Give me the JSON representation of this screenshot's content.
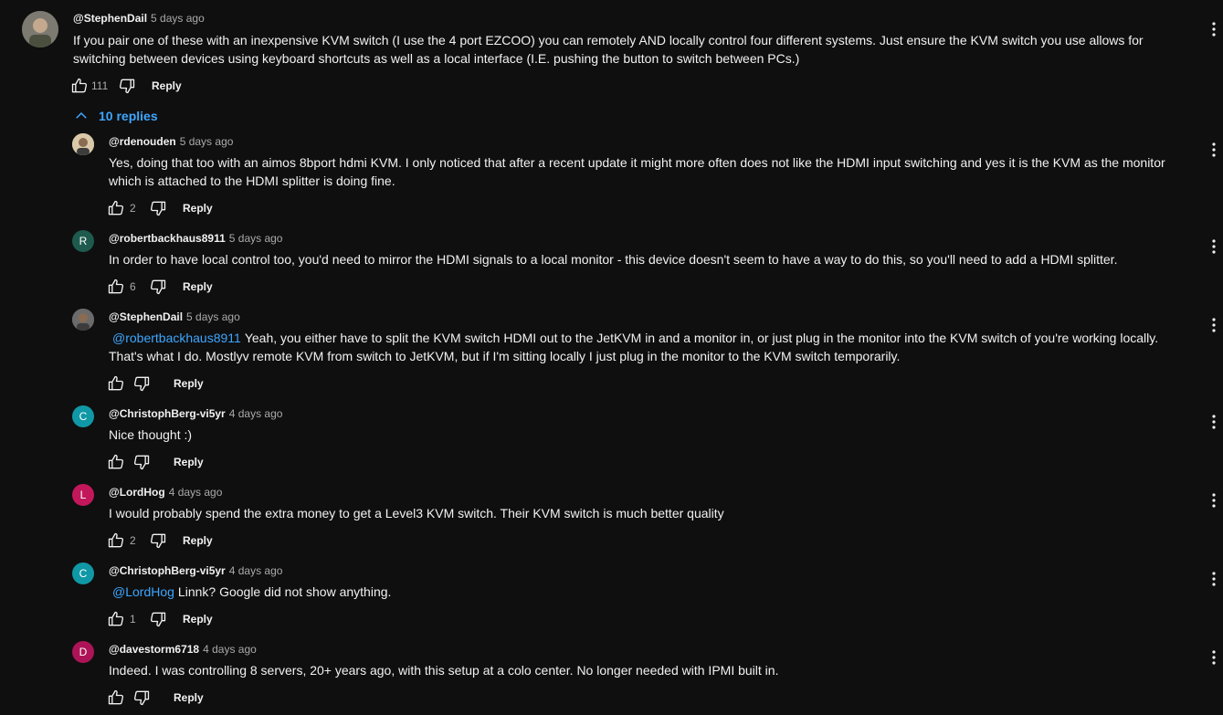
{
  "top_comment": {
    "author": "@StephenDail",
    "time": "5 days ago",
    "text_line1": "If you pair one of these with an inexpensive KVM switch (I use the 4 port EZCOO) you can remotely AND locally control four different systems. Just ensure the KVM switch you use allows for",
    "text_line2": "switching between devices using keyboard shortcuts as well as a local interface (I.E. pushing the button to switch between PCs.)",
    "likes": "111",
    "reply_label": "Reply"
  },
  "replies_toggle": {
    "label": "10 replies"
  },
  "replies": [
    {
      "author": "@rdenouden",
      "time": "5 days ago",
      "avatar_letter": "",
      "avatar_color": "#d9c9a8",
      "mention": "",
      "text": "Yes, doing that too with an aimos 8bport hdmi KVM. I only noticed that after a recent update it might more often does not like the HDMI  input switching and yes it is the KVM as the monitor which is attached to the HDMI splitter is doing fine.",
      "likes": "2",
      "reply_label": "Reply"
    },
    {
      "author": "@robertbackhaus8911",
      "time": "5 days ago",
      "avatar_letter": "R",
      "avatar_color": "#1e5b4e",
      "mention": "",
      "text": "In order to have local control too, you'd need to mirror the HDMI signals to a local monitor - this device doesn't seem to have a way to do this, so you'll need to add a HDMI splitter.",
      "likes": "6",
      "reply_label": "Reply"
    },
    {
      "author": "@StephenDail",
      "time": "5 days ago",
      "avatar_letter": "",
      "avatar_color": "#6b6b6b",
      "mention": "@robertbackhaus8911",
      "text": "Yeah, you either have to split the KVM switch HDMI out to the JetKVM in and a monitor in, or just plug in the monitor into the KVM switch of you're working locally. That's what I do. Mostlyv remote KVM from switch to JetKVM, but if I'm sitting locally I just plug in the monitor to the KVM switch temporarily.",
      "likes": "",
      "reply_label": "Reply"
    },
    {
      "author": "@ChristophBerg-vi5yr",
      "time": "4 days ago",
      "avatar_letter": "C",
      "avatar_color": "#1098a6",
      "mention": "",
      "text": "Nice thought :)",
      "likes": "",
      "reply_label": "Reply"
    },
    {
      "author": "@LordHog",
      "time": "4 days ago",
      "avatar_letter": "L",
      "avatar_color": "#c2185b",
      "mention": "",
      "text": "I would probably spend the extra money to get a Level3 KVM switch.  Their KVM switch is much better quality",
      "likes": "2",
      "reply_label": "Reply"
    },
    {
      "author": "@ChristophBerg-vi5yr",
      "time": "4 days ago",
      "avatar_letter": "C",
      "avatar_color": "#1098a6",
      "mention": "@LordHog",
      "text": "Linnk? Google did not show anything.",
      "likes": "1",
      "reply_label": "Reply"
    },
    {
      "author": "@davestorm6718",
      "time": "4 days ago",
      "avatar_letter": "D",
      "avatar_color": "#ad1457",
      "mention": "",
      "text": "Indeed. I was controlling 8 servers, 20+ years ago, with this setup at a colo center.  No longer needed with IPMI built in.",
      "likes": "",
      "reply_label": "Reply"
    }
  ],
  "colors": {
    "background": "#0f0f0f",
    "text": "#f1f1f1",
    "secondary": "#aaaaaa",
    "link": "#3ea6ff"
  },
  "icons": [
    "thumbs-up-icon",
    "thumbs-down-icon",
    "kebab-menu-icon",
    "chevron-up-icon"
  ]
}
